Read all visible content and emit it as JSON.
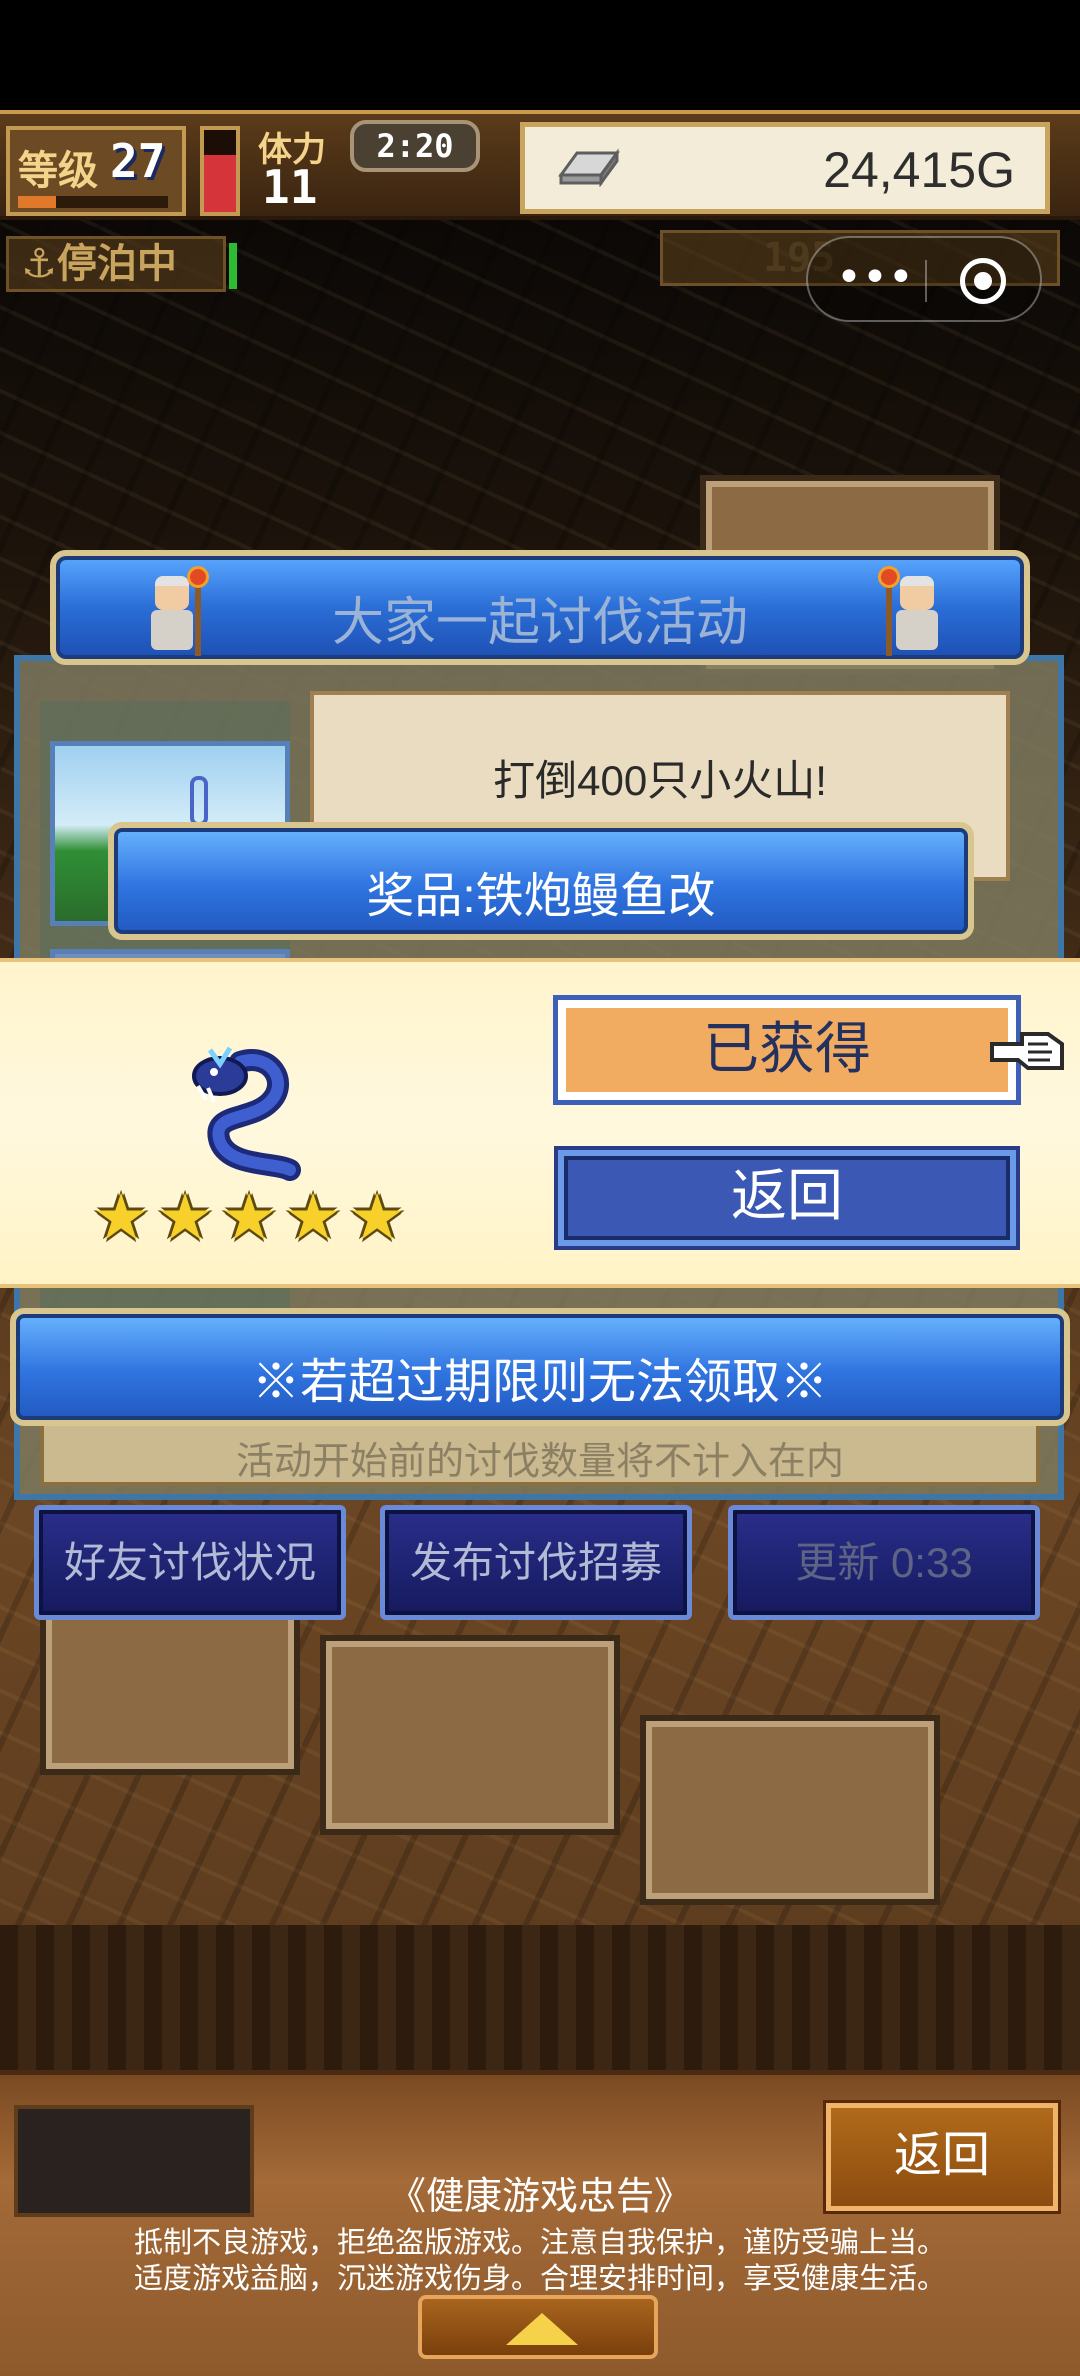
{
  "status_bar": {
    "level_label": "等级",
    "level_value": "27",
    "level_progress": 0.25,
    "stamina_label": "体力",
    "stamina_value": "11",
    "stamina_fill": 0.7,
    "timer": "2:20",
    "gold": "24,415G"
  },
  "dock_status": {
    "label": "停泊中",
    "resource_count": "195"
  },
  "miniprogram": {
    "menu_icon": "more-dots-icon",
    "close_icon": "target-circle-icon"
  },
  "event": {
    "title": "大家一起讨伐活动",
    "task": "打倒400只小火山!",
    "footer_note": "活动开始前的讨伐数量将不计入在内"
  },
  "reward": {
    "prize_label": "奖品:铁炮鳗鱼改",
    "stars": 5,
    "obtained_button": "已获得",
    "back_button": "返回",
    "monster_icon": "blue-serpent-icon"
  },
  "deadline_notice": "※若超过期限则无法领取※",
  "actions": [
    {
      "label": "好友讨伐状况"
    },
    {
      "label": "发布讨伐招募"
    },
    {
      "label": "更新 0:33"
    }
  ],
  "health_notice": {
    "title": "《健康游戏忠告》",
    "line1": "抵制不良游戏，拒绝盗版游戏。注意自我保护，谨防受骗上当。",
    "line2": "适度游戏益脑，沉迷游戏伤身。合理安排时间，享受健康生活。",
    "back_button": "返回"
  },
  "colors": {
    "banner_blue": "#2f74e0",
    "reward_bg": "#fff4cc",
    "obtained_orange": "#f2ac62",
    "star_yellow": "#f7d12a"
  }
}
